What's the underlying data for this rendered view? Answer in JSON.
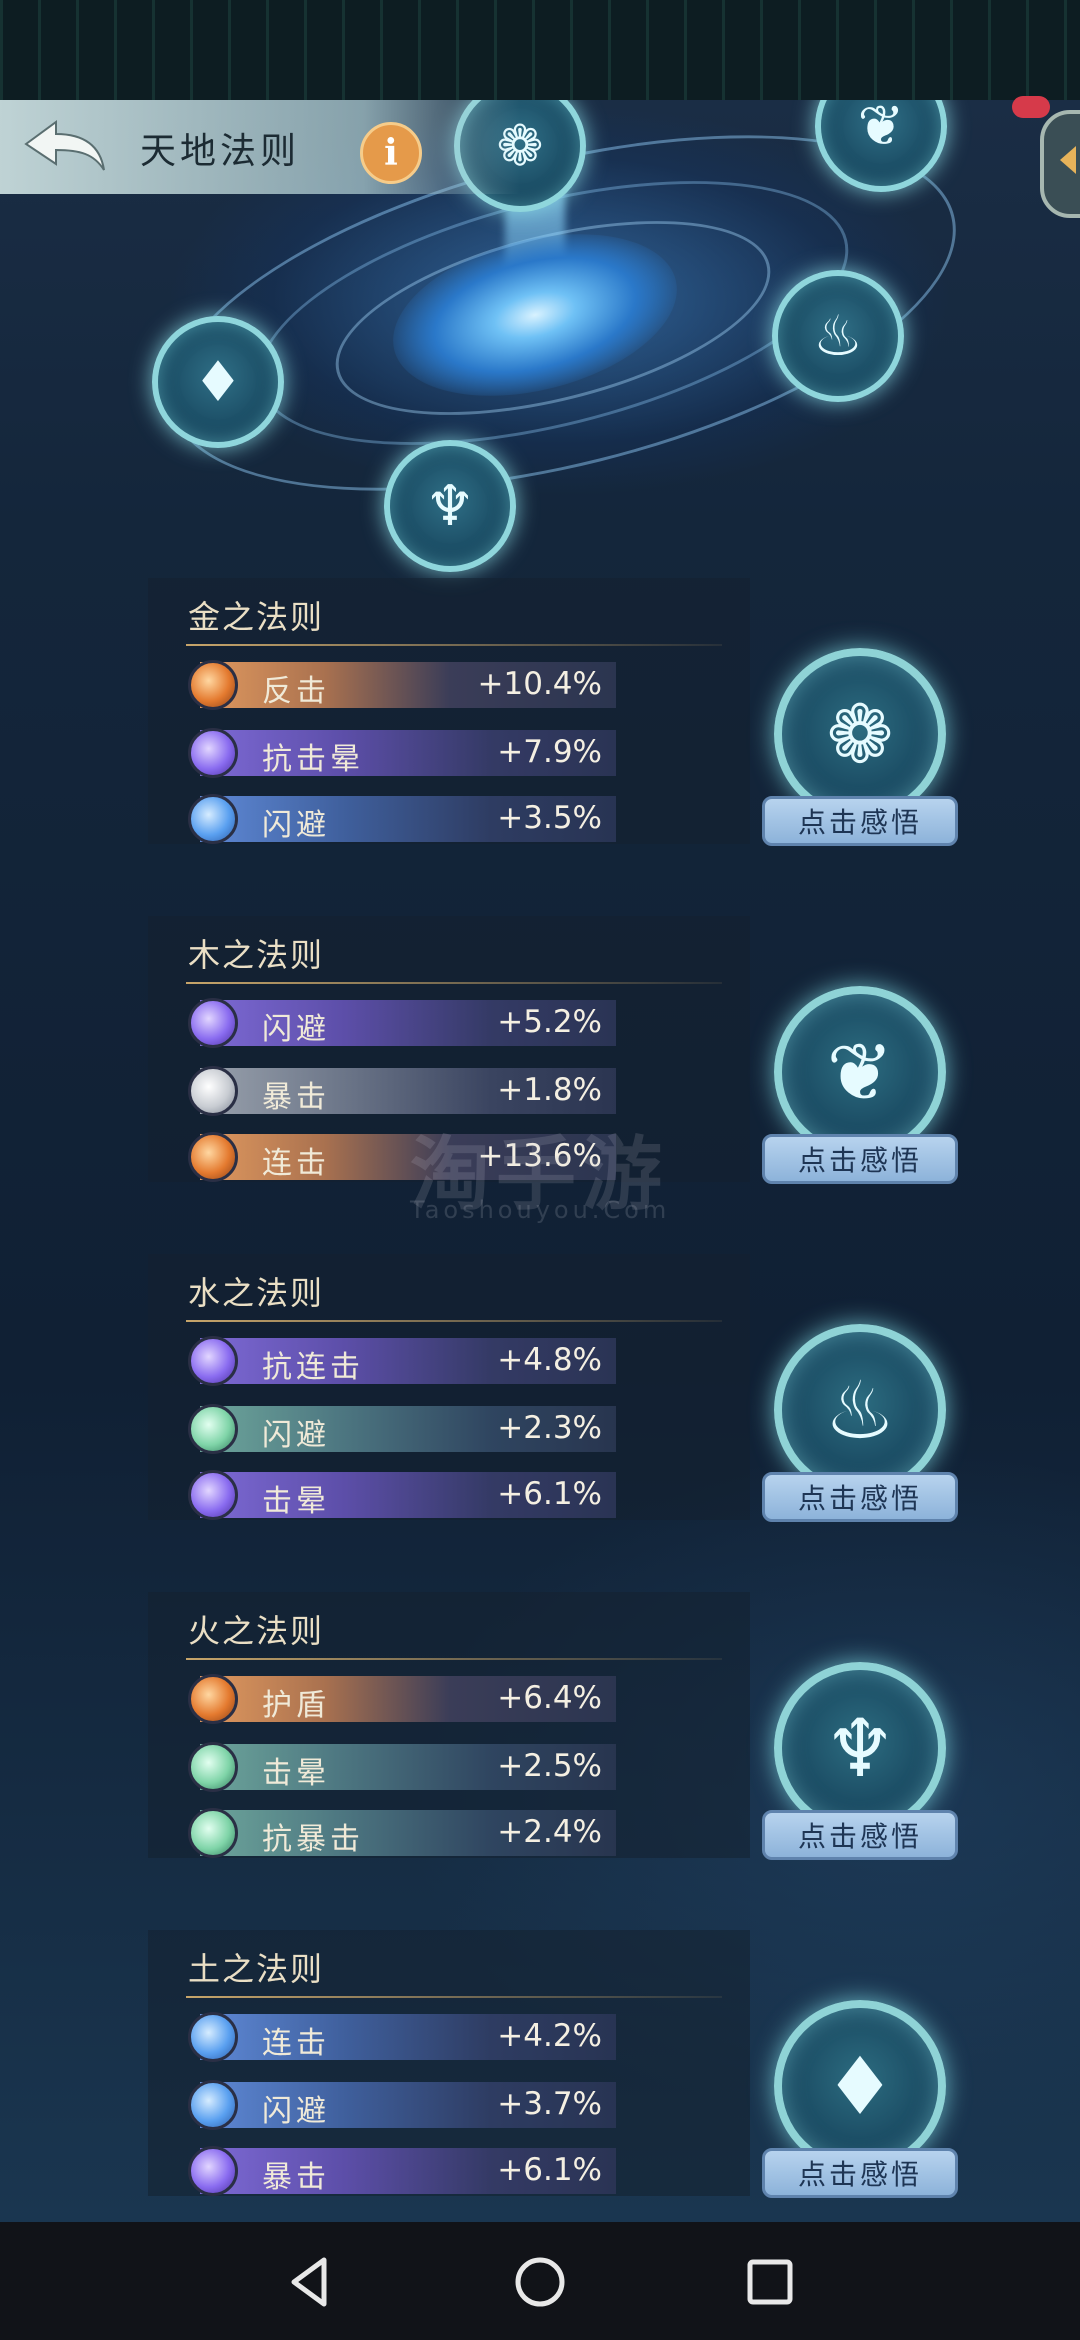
{
  "header": {
    "title": "天地法则",
    "info_glyph": "i"
  },
  "orb_icons": [
    "swirl-icon",
    "leaf-icon",
    "water-drop-icon",
    "flame-icon",
    "crystal-icon"
  ],
  "enlighten_label": "点击感悟",
  "sections": [
    {
      "title": "金之法则",
      "icon": "swirl-icon",
      "glyph": "❁",
      "stats": [
        {
          "name": "反击",
          "value": "+10.4%",
          "color": "orange"
        },
        {
          "name": "抗击晕",
          "value": "+7.9%",
          "color": "purple"
        },
        {
          "name": "闪避",
          "value": "+3.5%",
          "color": "blue"
        }
      ]
    },
    {
      "title": "木之法则",
      "icon": "leaf-icon",
      "glyph": "❦",
      "stats": [
        {
          "name": "闪避",
          "value": "+5.2%",
          "color": "purple"
        },
        {
          "name": "暴击",
          "value": "+1.8%",
          "color": "gray"
        },
        {
          "name": "连击",
          "value": "+13.6%",
          "color": "orange"
        }
      ]
    },
    {
      "title": "水之法则",
      "icon": "water-drop-icon",
      "glyph": "♨",
      "stats": [
        {
          "name": "抗连击",
          "value": "+4.8%",
          "color": "purple"
        },
        {
          "name": "闪避",
          "value": "+2.3%",
          "color": "green"
        },
        {
          "name": "击晕",
          "value": "+6.1%",
          "color": "purple"
        }
      ]
    },
    {
      "title": "火之法则",
      "icon": "flame-icon",
      "glyph": "♆",
      "stats": [
        {
          "name": "护盾",
          "value": "+6.4%",
          "color": "orange"
        },
        {
          "name": "击晕",
          "value": "+2.5%",
          "color": "green"
        },
        {
          "name": "抗暴击",
          "value": "+2.4%",
          "color": "green"
        }
      ]
    },
    {
      "title": "土之法则",
      "icon": "crystal-icon",
      "glyph": "♦",
      "stats": [
        {
          "name": "连击",
          "value": "+4.2%",
          "color": "blue"
        },
        {
          "name": "闪避",
          "value": "+3.7%",
          "color": "blue"
        },
        {
          "name": "暴击",
          "value": "+6.1%",
          "color": "purple"
        }
      ]
    }
  ],
  "watermark": {
    "main": "淘手游",
    "sub": "Taoshouyou.Com"
  },
  "navbar": {
    "back": "back-nav-icon",
    "home": "home-nav-icon",
    "recents": "recents-nav-icon"
  }
}
